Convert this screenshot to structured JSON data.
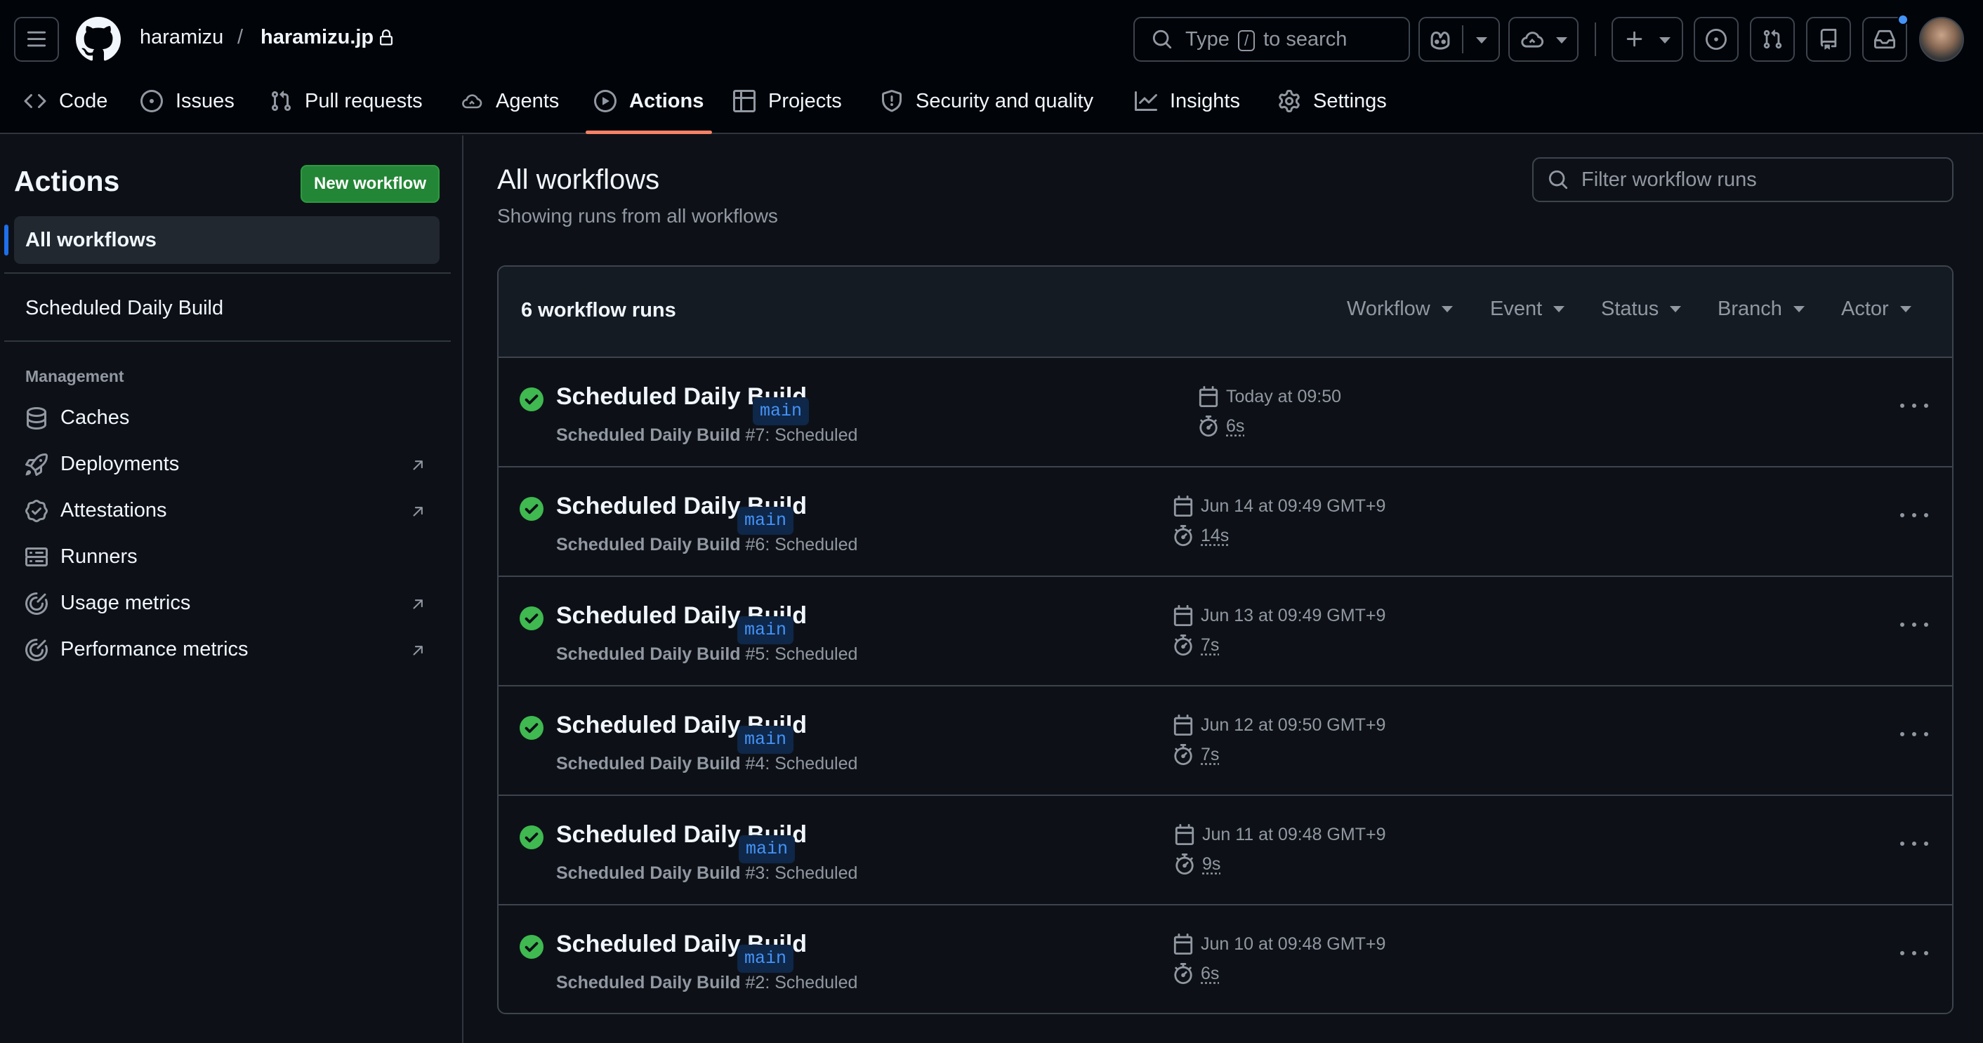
{
  "header": {
    "owner": "haramizu",
    "separator": "/",
    "repo": "haramizu.jp",
    "search": {
      "prefix": "Type",
      "key": "/",
      "suffix": "to search"
    }
  },
  "nav": {
    "tabs": [
      {
        "label": "Code",
        "icon": "code-icon"
      },
      {
        "label": "Issues",
        "icon": "issue-icon"
      },
      {
        "label": "Pull requests",
        "icon": "pull-request-icon"
      },
      {
        "label": "Agents",
        "icon": "agent-icon"
      },
      {
        "label": "Actions",
        "icon": "play-icon",
        "selected": true
      },
      {
        "label": "Projects",
        "icon": "table-icon"
      },
      {
        "label": "Security and quality",
        "icon": "shield-icon"
      },
      {
        "label": "Insights",
        "icon": "graph-icon"
      },
      {
        "label": "Settings",
        "icon": "gear-icon"
      }
    ]
  },
  "sidebar": {
    "title": "Actions",
    "new_workflow": "New workflow",
    "all_workflows": "All workflows",
    "workflows": [
      "Scheduled Daily Build"
    ],
    "management_heading": "Management",
    "management": [
      {
        "label": "Caches",
        "icon": "database-icon",
        "external": false
      },
      {
        "label": "Deployments",
        "icon": "rocket-icon",
        "external": true
      },
      {
        "label": "Attestations",
        "icon": "verified-icon",
        "external": true
      },
      {
        "label": "Runners",
        "icon": "server-icon",
        "external": false
      },
      {
        "label": "Usage metrics",
        "icon": "meter-icon",
        "external": true
      },
      {
        "label": "Performance metrics",
        "icon": "meter-icon",
        "external": true
      }
    ]
  },
  "main": {
    "title": "All workflows",
    "subtitle": "Showing runs from all workflows",
    "filter_placeholder": "Filter workflow runs",
    "count_label": "6 workflow runs",
    "filters": [
      "Workflow",
      "Event",
      "Status",
      "Branch",
      "Actor"
    ],
    "runs": [
      {
        "title": "Scheduled Daily Build",
        "workflow": "Scheduled Daily Build",
        "number": "#7",
        "event": ": Scheduled",
        "branch": "main",
        "date": "Today at 09:50",
        "duration": "6s"
      },
      {
        "title": "Scheduled Daily Build",
        "workflow": "Scheduled Daily Build",
        "number": "#6",
        "event": ": Scheduled",
        "branch": "main",
        "date": "Jun 14 at 09:49 GMT+9",
        "duration": "14s"
      },
      {
        "title": "Scheduled Daily Build",
        "workflow": "Scheduled Daily Build",
        "number": "#5",
        "event": ": Scheduled",
        "branch": "main",
        "date": "Jun 13 at 09:49 GMT+9",
        "duration": "7s"
      },
      {
        "title": "Scheduled Daily Build",
        "workflow": "Scheduled Daily Build",
        "number": "#4",
        "event": ": Scheduled",
        "branch": "main",
        "date": "Jun 12 at 09:50 GMT+9",
        "duration": "7s"
      },
      {
        "title": "Scheduled Daily Build",
        "workflow": "Scheduled Daily Build",
        "number": "#3",
        "event": ": Scheduled",
        "branch": "main",
        "date": "Jun 11 at 09:48 GMT+9",
        "duration": "9s"
      },
      {
        "title": "Scheduled Daily Build",
        "workflow": "Scheduled Daily Build",
        "number": "#2",
        "event": ": Scheduled",
        "branch": "main",
        "date": "Jun 10 at 09:48 GMT+9",
        "duration": "6s"
      }
    ]
  },
  "colors": {
    "success": "#3fb950",
    "accent": "#f78166",
    "button": "#238636",
    "link": "#4493f8"
  }
}
